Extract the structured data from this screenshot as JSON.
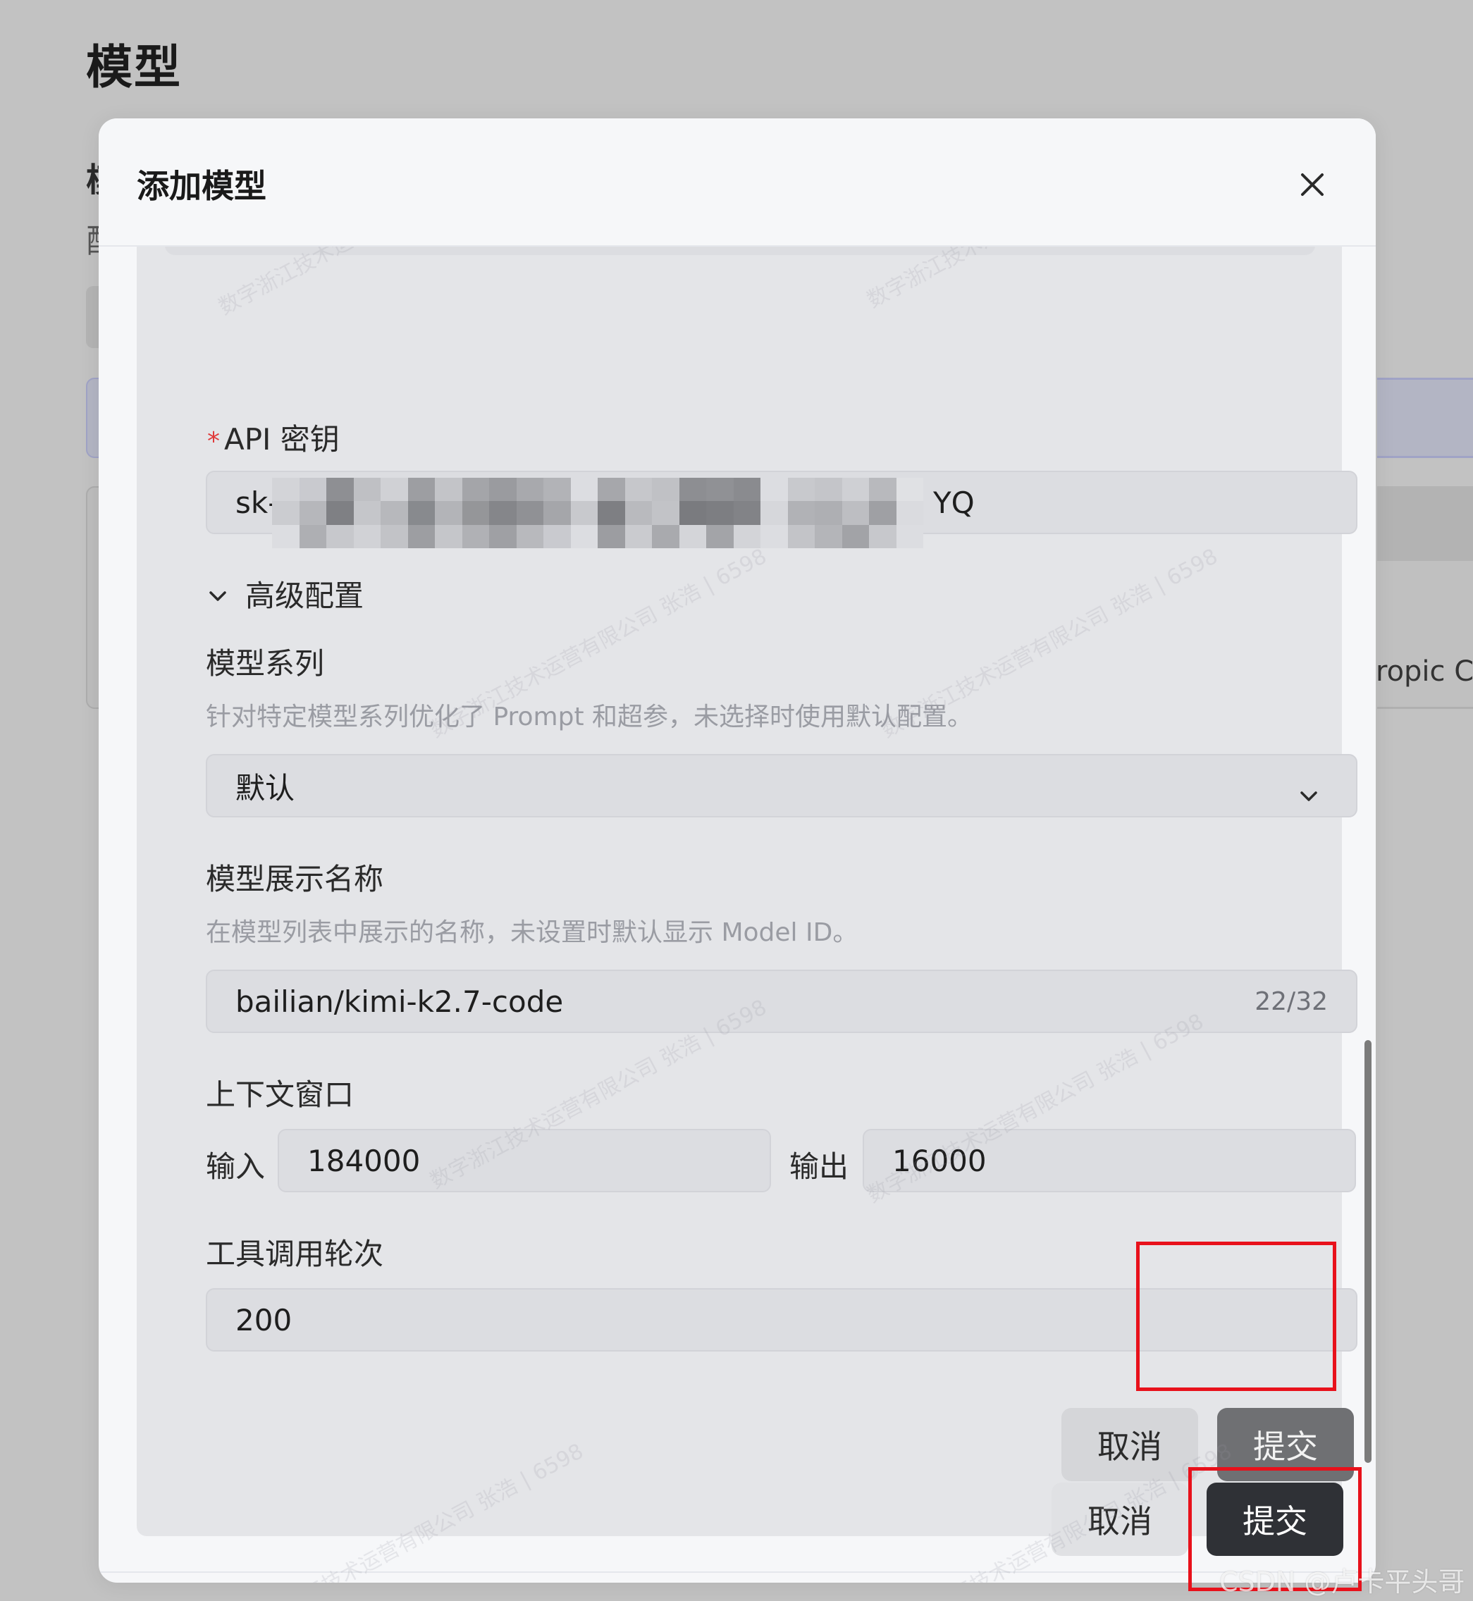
{
  "background": {
    "page_title": "模型",
    "fragment_1": "模",
    "fragment_2": "配",
    "right_cell_text": "ropic Co"
  },
  "modal": {
    "title": "添加模型",
    "close_icon": "close-icon",
    "api_key": {
      "label": "API 密钥",
      "required": true,
      "value_prefix": "sk-·",
      "value_suffix": "YQ",
      "masked": true
    },
    "advanced": {
      "label": "高级配置",
      "expanded": true,
      "icon": "chevron-down-icon"
    },
    "model_family": {
      "label": "模型系列",
      "hint": "针对特定模型系列优化了 Prompt 和超参，未选择时使用默认配置。",
      "selected": "默认"
    },
    "display_name": {
      "label": "模型展示名称",
      "hint": "在模型列表中展示的名称，未设置时默认显示 Model ID。",
      "value": "bailian/kimi-k2.7-code",
      "counter": "22/32"
    },
    "context_window": {
      "label": "上下文窗口",
      "input_label": "输入",
      "input_value": "184000",
      "output_label": "输出",
      "output_value": "16000"
    },
    "tool_rounds": {
      "label": "工具调用轮次",
      "value": "200"
    },
    "inner_buttons": {
      "cancel": "取消",
      "submit": "提交"
    },
    "footer_buttons": {
      "cancel": "取消",
      "submit": "提交"
    }
  },
  "watermark_text": "数字浙江技术运营有限公司 张浩 | 6598",
  "credit": "CSDN @卢卡平头哥",
  "colors": {
    "highlight": "#e8111b",
    "submit_dark": "#2f3136",
    "required": "#e03a3a"
  }
}
